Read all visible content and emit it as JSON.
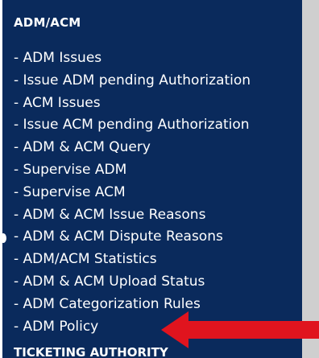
{
  "sidebar": {
    "section_title": "ADM/ACM",
    "items": [
      {
        "label": "- ADM Issues"
      },
      {
        "label": "- Issue ADM pending Authorization"
      },
      {
        "label": "- ACM Issues"
      },
      {
        "label": "- Issue ACM pending Authorization"
      },
      {
        "label": "- ADM & ACM Query"
      },
      {
        "label": "- Supervise ADM"
      },
      {
        "label": "- Supervise ACM"
      },
      {
        "label": "- ADM & ACM Issue Reasons"
      },
      {
        "label": "- ADM & ACM Dispute Reasons"
      },
      {
        "label": "- ADM/ACM Statistics"
      },
      {
        "label": "- ADM & ACM Upload Status"
      },
      {
        "label": "- ADM Categorization Rules"
      },
      {
        "label": "- ADM Policy"
      }
    ],
    "next_section_title": "TICKETING AUTHORITY"
  },
  "colors": {
    "panel_background": "#0a2a5c",
    "text": "#ffffff",
    "arrow": "#e0141e",
    "right_strip": "#cfcfcf"
  },
  "icons": {
    "pointer": "red-arrow-icon"
  }
}
